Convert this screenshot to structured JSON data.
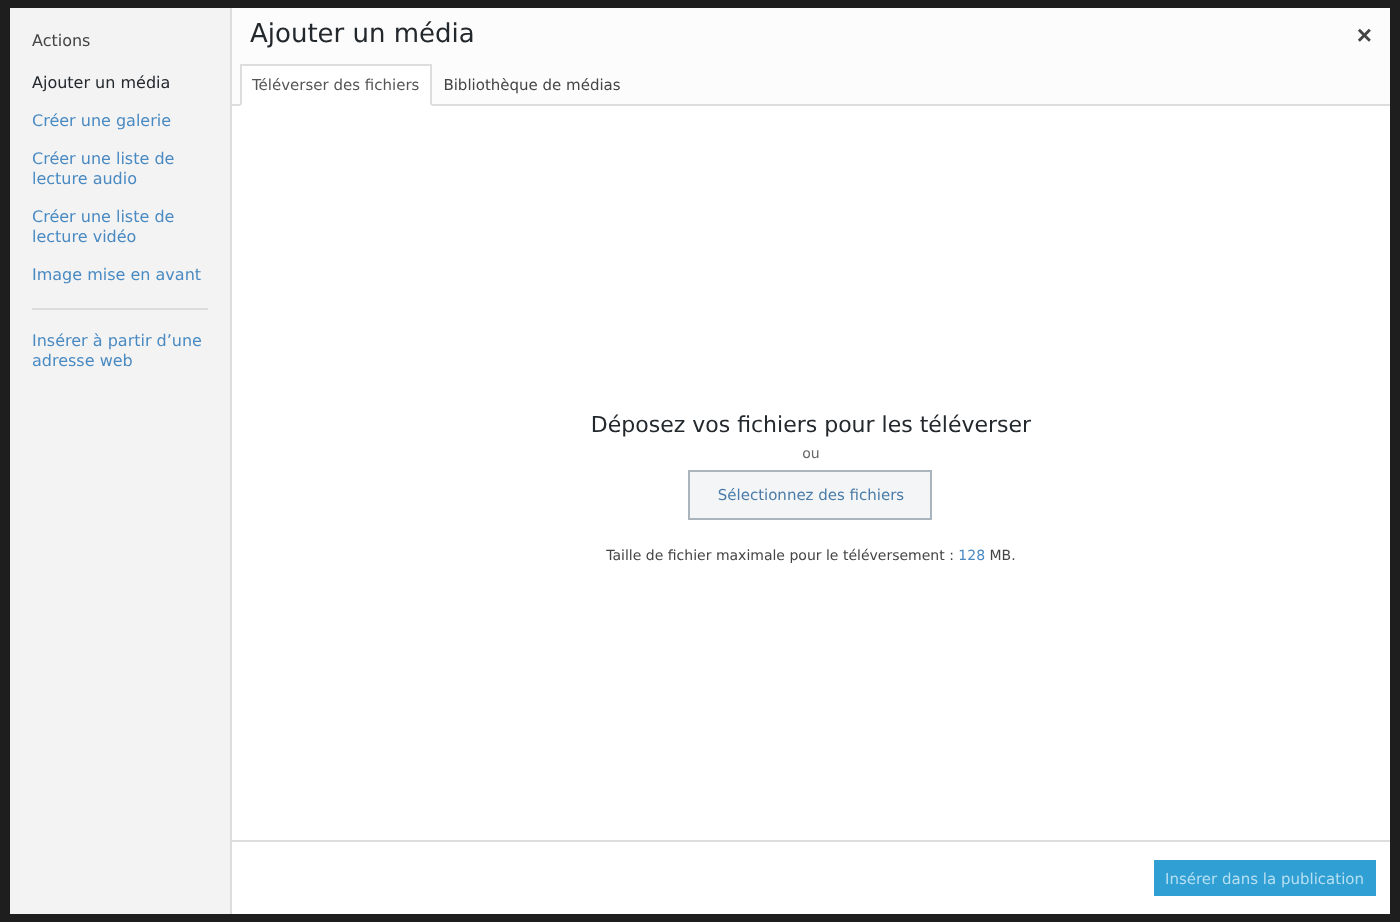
{
  "sidebar": {
    "heading": "Actions",
    "groups": [
      {
        "items": [
          {
            "label": "Ajouter un média",
            "selected": true
          },
          {
            "label": "Créer une galerie",
            "selected": false
          },
          {
            "label": "Créer une liste de lecture audio",
            "selected": false
          },
          {
            "label": "Créer une liste de lecture vidéo",
            "selected": false
          },
          {
            "label": "Image mise en avant",
            "selected": false
          }
        ]
      },
      {
        "items": [
          {
            "label": "Insérer à partir d’une adresse web",
            "selected": false
          }
        ]
      }
    ]
  },
  "window": {
    "title": "Ajouter un média",
    "close": "×"
  },
  "tabs": [
    {
      "label": "Téléverser des fichiers",
      "selected": true
    },
    {
      "label": "Bibliothèque de médias",
      "selected": false
    }
  ],
  "uploader": {
    "heading": "Déposez vos fichiers pour les téléverser",
    "separator": "ou",
    "button": "Sélectionnez des fichiers",
    "max_size": {
      "before": "Taille de fichier maximale pour le téléversement : ",
      "value": "128",
      "after": " MB."
    }
  },
  "footer": {
    "button": {
      "label": "Insérer dans la publication",
      "disabled": true
    }
  }
}
